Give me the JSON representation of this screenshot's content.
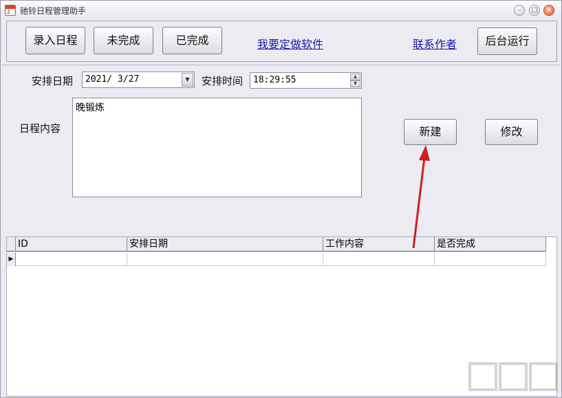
{
  "window": {
    "title": "驰铃日程管理助手",
    "icon": "calendar-icon",
    "icon_number": "2",
    "controls": [
      "minimize",
      "maximize",
      "close"
    ]
  },
  "toolbar": {
    "btn_enter": "录入日程",
    "btn_unfinished": "未完成",
    "btn_finished": "已完成",
    "link_custom": "我要定做软件",
    "link_contact": "联系作者",
    "btn_background": "后台运行"
  },
  "form": {
    "date_label": "安排日期",
    "date_value": "2021/ 3/27",
    "time_label": "安排时间",
    "time_value": "18:29:55",
    "content_label": "日程内容",
    "content_value": "晚锻炼",
    "btn_new": "新建",
    "btn_modify": "修改"
  },
  "grid": {
    "columns": [
      "ID",
      "安排日期",
      "工作内容",
      "是否完成"
    ],
    "rows": [
      [
        "",
        "",
        "",
        ""
      ]
    ],
    "current_row_marker": "▶"
  },
  "colors": {
    "window_bg": "#ecebf2",
    "link": "#1a1aa8",
    "annotation_arrow": "#cc1f1f",
    "close_button": "#e0532a"
  }
}
